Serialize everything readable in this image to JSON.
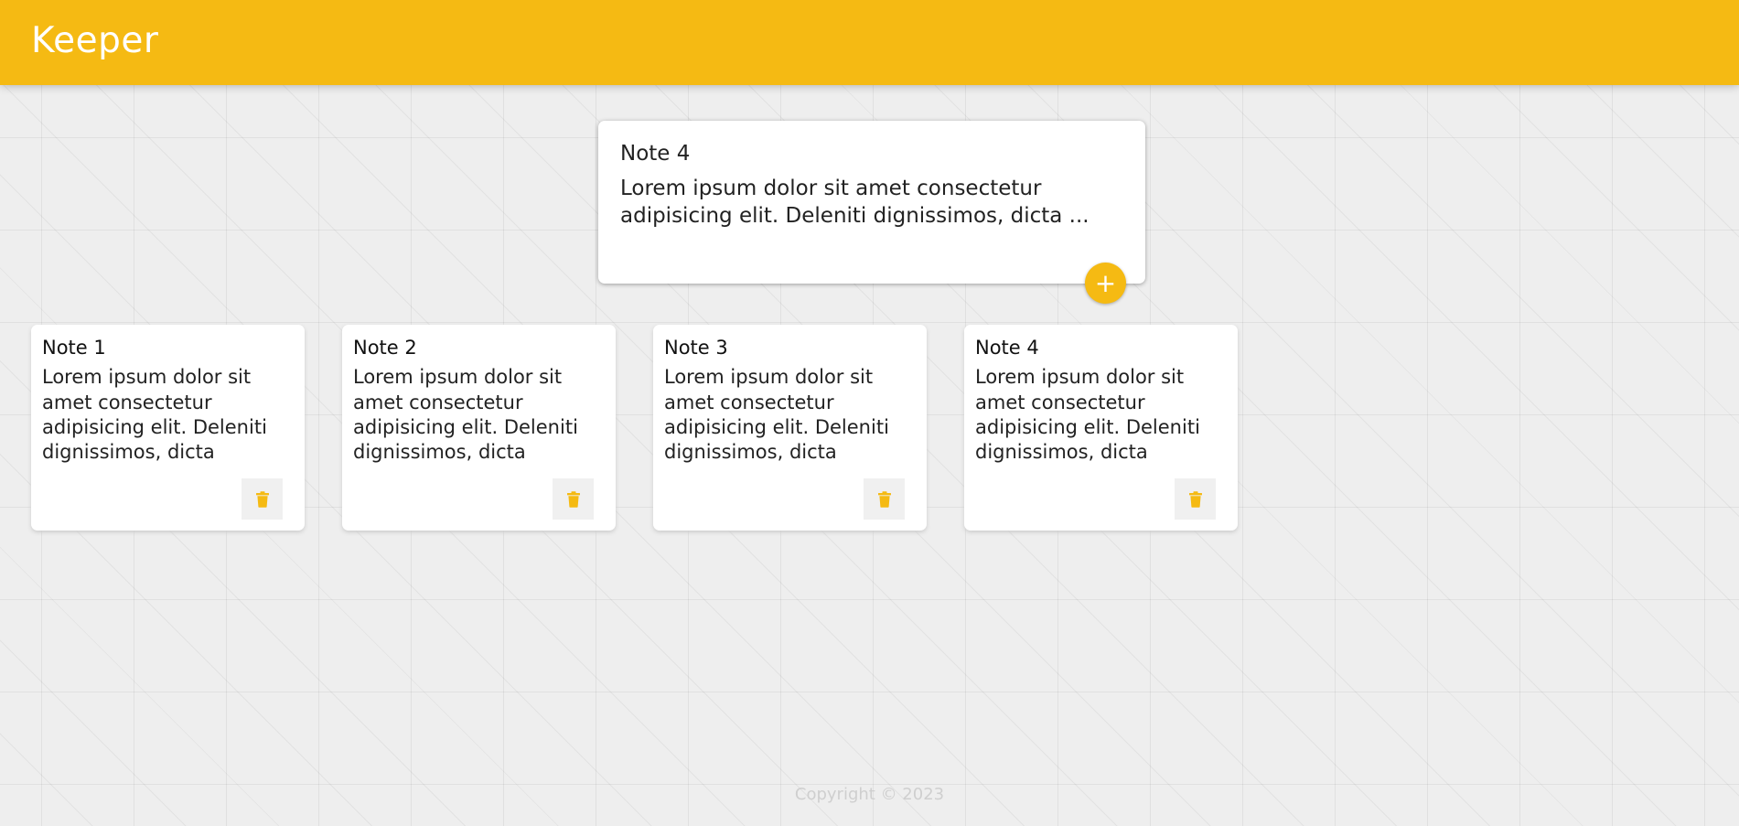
{
  "header": {
    "app_title": "Keeper"
  },
  "create_area": {
    "title_value": "Note 4",
    "content_value": "Lorem ipsum dolor sit amet consectetur adipisicing elit. Deleniti dignissimos, dicta ...",
    "add_button_glyph": "+",
    "add_icon": "plus-icon"
  },
  "notes": [
    {
      "title": "Note 1",
      "content": "Lorem ipsum dolor sit amet consectetur adipisicing elit. Deleniti dignissimos, dicta",
      "delete_icon": "trash-icon"
    },
    {
      "title": "Note 2",
      "content": "Lorem ipsum dolor sit amet consectetur adipisicing elit. Deleniti dignissimos, dicta",
      "delete_icon": "trash-icon"
    },
    {
      "title": "Note 3",
      "content": "Lorem ipsum dolor sit amet consectetur adipisicing elit. Deleniti dignissimos, dicta",
      "delete_icon": "trash-icon"
    },
    {
      "title": "Note 4",
      "content": "Lorem ipsum dolor sit amet consectetur adipisicing elit. Deleniti dignissimos, dicta",
      "delete_icon": "trash-icon"
    }
  ],
  "footer": {
    "copyright": "Copyright © 2023"
  },
  "colors": {
    "accent": "#f5ba13",
    "background": "#eeeeee",
    "card": "#ffffff",
    "footer_text": "#cfcfcf"
  }
}
